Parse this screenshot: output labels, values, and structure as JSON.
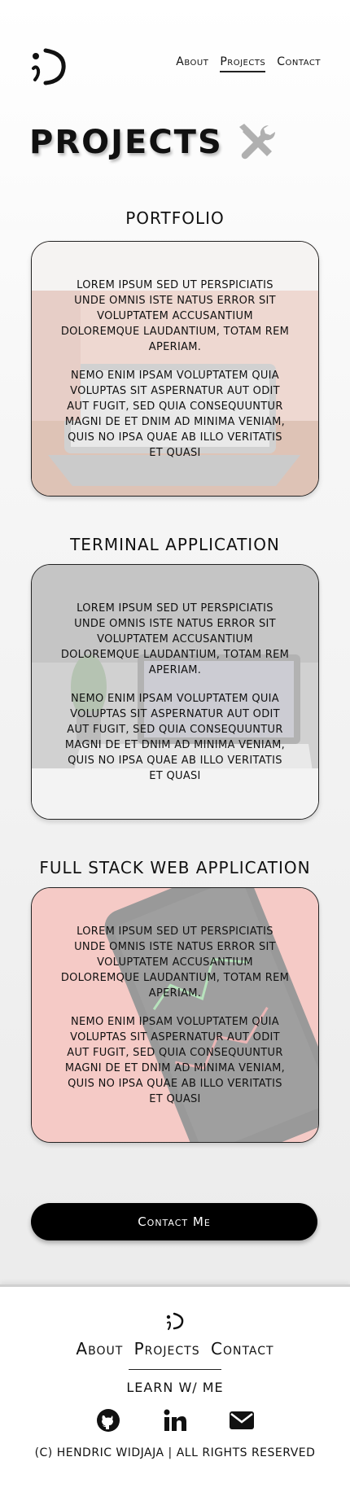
{
  "header": {
    "logo_text": ";)",
    "nav": [
      "About",
      "Projects",
      "Contact"
    ],
    "active_nav": "Projects"
  },
  "page": {
    "title": "Projects",
    "title_icon": "tools-icon"
  },
  "projects": [
    {
      "title": "Portfolio",
      "image": "laptop-desk-photo",
      "paragraphs": [
        "Lorem ipsum sed ut perspiciatis unde omnis iste natus error sit voluptatem accusantium doloremque laudantium, totam rem aperiam.",
        "Nemo enim ipsam voluptatem quia voluptas sit aspernatur aut odit aut fugit, sed quia consequuntur magni de et dnim ad minima veniam, quis no ipsa quae ab illo  veritatis et quasi"
      ]
    },
    {
      "title": "Terminal Application",
      "image": "laptop-plant-photo",
      "paragraphs": [
        "Lorem ipsum sed ut perspiciatis unde omnis iste natus error sit voluptatem accusantium doloremque laudantium, totam rem aperiam.",
        "Nemo enim ipsam voluptatem quia voluptas sit aspernatur aut odit aut fugit, sed quia consequuntur magni de et dnim ad minima veniam, quis no ipsa quae ab illo  veritatis et quasi"
      ]
    },
    {
      "title": "Full Stack Web Application",
      "image": "phone-stocks-photo",
      "paragraphs": [
        "Lorem ipsum sed ut perspiciatis unde omnis iste natus error sit voluptatem accusantium doloremque laudantium, totam rem aperiam.",
        "Nemo enim ipsam voluptatem quia voluptas sit aspernatur aut odit aut fugit, sed quia consequuntur magni de et dnim ad minima veniam, quis no ipsa quae ab illo  veritatis et quasi"
      ]
    }
  ],
  "contact_button": "Contact Me",
  "footer": {
    "logo_text": ";)",
    "nav": [
      "About",
      "Projects",
      "Contact"
    ],
    "tagline": "Learn w/ me",
    "socials": [
      "github-icon",
      "linkedin-icon",
      "email-icon"
    ],
    "copyright": "(c) Hendric Widjaja | All rights reserved"
  },
  "colors": {
    "accent": "#000000",
    "card_portfolio": "#d9a89a",
    "card_terminal": "#9a9a9a",
    "card_fullstack": "#e98b80"
  }
}
